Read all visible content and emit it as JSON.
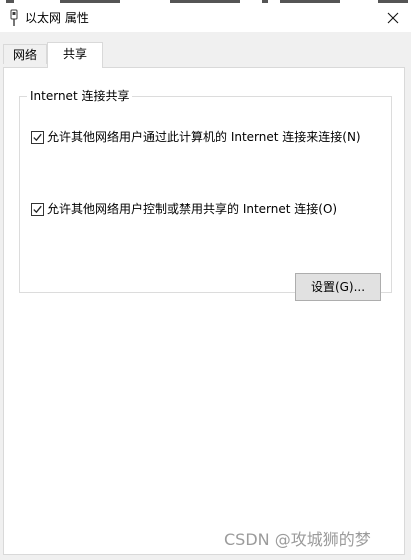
{
  "window": {
    "title": "以太网 属性",
    "close_icon": "close-icon",
    "title_icon": "network-adapter-icon"
  },
  "tabs": [
    {
      "label": "网络",
      "active": false
    },
    {
      "label": "共享",
      "active": true
    }
  ],
  "sharing": {
    "group_title": "Internet 连接共享",
    "options": [
      {
        "label": "允许其他网络用户通过此计算机的 Internet 连接来连接(N)",
        "checked": true
      },
      {
        "label": "允许其他网络用户控制或禁用共享的 Internet 连接(O)",
        "checked": true
      }
    ],
    "settings_button": "设置(G)..."
  },
  "watermark": "CSDN @攻城狮的梦",
  "colors": {
    "window_bg": "#f0f0f0",
    "panel_bg": "#ffffff",
    "border": "#d9d9d9",
    "button_bg": "#e1e1e1",
    "button_border": "#adadad",
    "watermark_text": "#9b9b9b"
  }
}
